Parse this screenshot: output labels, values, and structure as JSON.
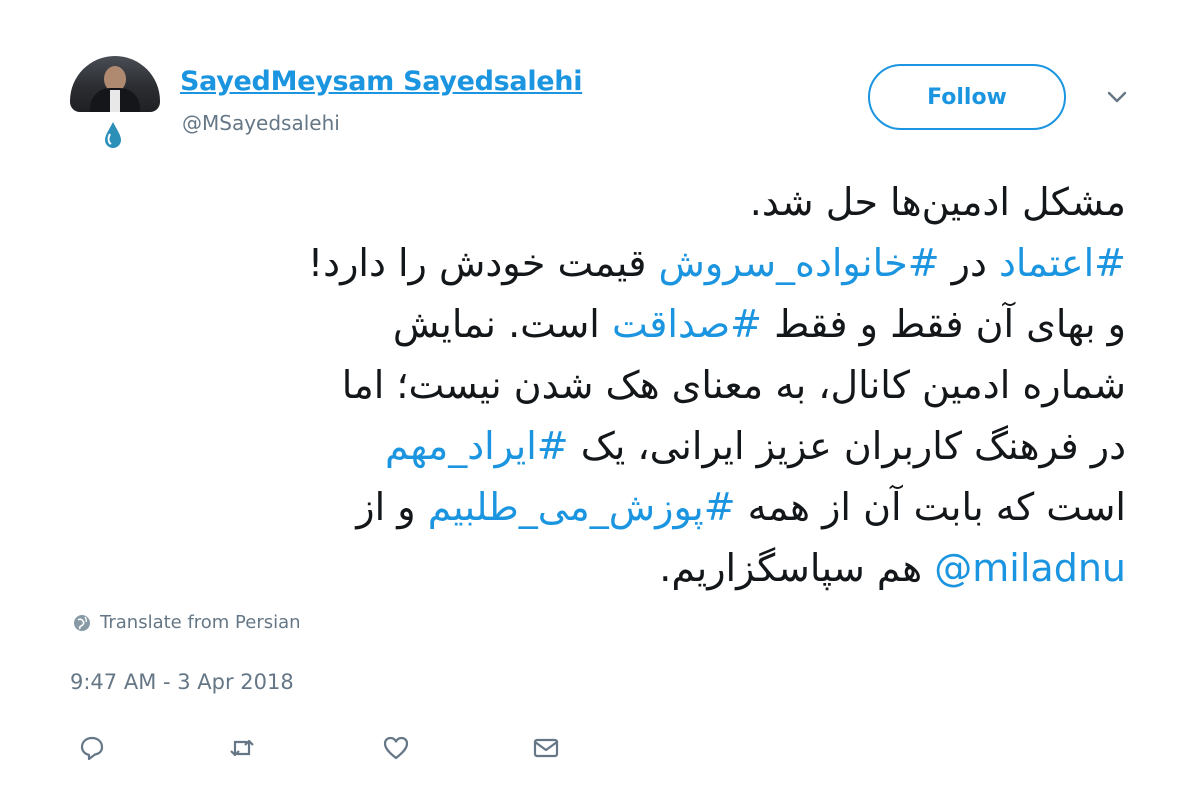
{
  "user": {
    "display_name": "SayedMeysam Sayedsalehi",
    "handle": "@MSayedsalehi"
  },
  "follow_label": "Follow",
  "tweet": {
    "lines": [
      [
        {
          "t": "text",
          "v": "مشکل ادمین‌ها حل شد."
        }
      ],
      [
        {
          "t": "tag",
          "v": "#اعتماد"
        },
        {
          "t": "text",
          "v": " در "
        },
        {
          "t": "tag",
          "v": "#خانواده_سروش"
        },
        {
          "t": "text",
          "v": " قیمت خودش را دارد!"
        }
      ],
      [
        {
          "t": "text",
          "v": "و بهای آن فقط و فقط "
        },
        {
          "t": "tag",
          "v": "#صداقت"
        },
        {
          "t": "text",
          "v": " است. نمایش"
        }
      ],
      [
        {
          "t": "text",
          "v": "شماره ادمین کانال، به معنای هک شدن نیست؛ اما"
        }
      ],
      [
        {
          "t": "text",
          "v": "در فرهنگ کاربران عزیز ایرانی، یک "
        },
        {
          "t": "tag",
          "v": "#ایراد_مهم"
        }
      ],
      [
        {
          "t": "text",
          "v": "است که بابت آن از همه "
        },
        {
          "t": "tag",
          "v": "#پوزش_می_طلبیم"
        },
        {
          "t": "text",
          "v": " و از"
        }
      ],
      [
        {
          "t": "mention",
          "v": "@miladnu"
        },
        {
          "t": "text",
          "v": " هم سپاسگزاریم."
        }
      ]
    ]
  },
  "translate_label": "Translate from Persian",
  "timestamp": "9:47 AM - 3 Apr 2018",
  "colors": {
    "link": "#1b95e0",
    "text": "#14171a",
    "muted": "#657786"
  },
  "icons": {
    "avatar_badge": "drop-icon",
    "caret": "chevron-down-icon",
    "translate": "globe-icon",
    "reply": "reply-icon",
    "retweet": "retweet-icon",
    "like": "heart-icon",
    "dm": "envelope-icon"
  }
}
